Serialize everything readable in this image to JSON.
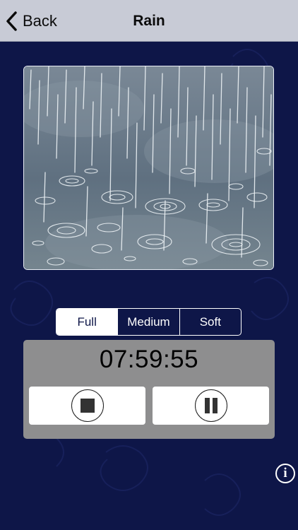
{
  "nav": {
    "back_label": "Back",
    "title": "Rain"
  },
  "volume": {
    "options": [
      "Full",
      "Medium",
      "Soft"
    ],
    "selected": "Full"
  },
  "timer": {
    "value": "07:59:55"
  },
  "icons": {
    "back": "chevron-left-icon",
    "stop": "stop-icon",
    "pause": "pause-icon",
    "info": "info-icon",
    "info_glyph": "i"
  },
  "colors": {
    "background": "#0e1648",
    "navbar": "#c8cbd6",
    "panel": "#8e8e8f",
    "accent": "#ffffff"
  }
}
